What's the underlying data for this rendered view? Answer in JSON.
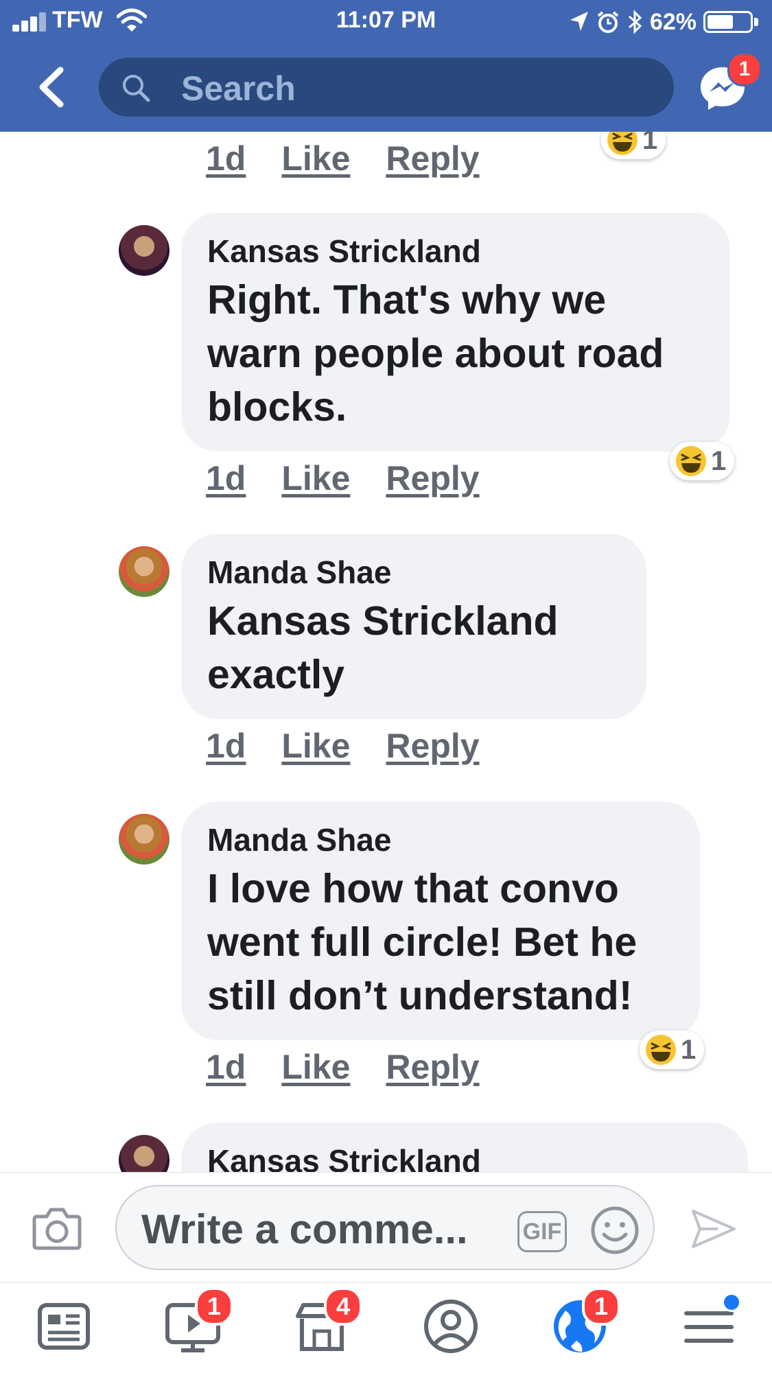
{
  "status_bar": {
    "carrier": "TFW",
    "time": "11:07 PM",
    "battery": "62%",
    "battery_level": 0.62
  },
  "header": {
    "search_placeholder": "Search",
    "messenger_badge": "1"
  },
  "comments": [
    {
      "timestamp": "1d",
      "like_label": "Like",
      "reply_label": "Reply",
      "reaction_count": "1"
    },
    {
      "author": "Kansas Strickland",
      "text": "Right. That's why we warn people about road blocks.",
      "timestamp": "1d",
      "like_label": "Like",
      "reply_label": "Reply",
      "reaction_count": "1"
    },
    {
      "author": "Manda Shae",
      "mention": "Kansas Strickland",
      "text": "exactly",
      "timestamp": "1d",
      "like_label": "Like",
      "reply_label": "Reply"
    },
    {
      "author": "Manda Shae",
      "text": "I love how that convo went full circle! Bet he still don’t understand!",
      "timestamp": "1d",
      "like_label": "Like",
      "reply_label": "Reply",
      "reaction_count": "1"
    },
    {
      "author": "Kansas Strickland"
    }
  ],
  "composer": {
    "placeholder": "Write a comme...",
    "gif_label": "GIF"
  },
  "tabbar": {
    "tabs": [
      {
        "icon": "news-feed-icon"
      },
      {
        "icon": "watch-icon",
        "badge": "1"
      },
      {
        "icon": "marketplace-icon",
        "badge": "4"
      },
      {
        "icon": "profile-icon"
      },
      {
        "icon": "notifications-globe-icon",
        "badge": "1"
      },
      {
        "icon": "menu-icon"
      }
    ]
  },
  "colors": {
    "brand_blue": "#4267b2",
    "search_bg": "#29487d",
    "bubble_bg": "#f0f2f5",
    "badge_red": "#fa3e3e"
  }
}
